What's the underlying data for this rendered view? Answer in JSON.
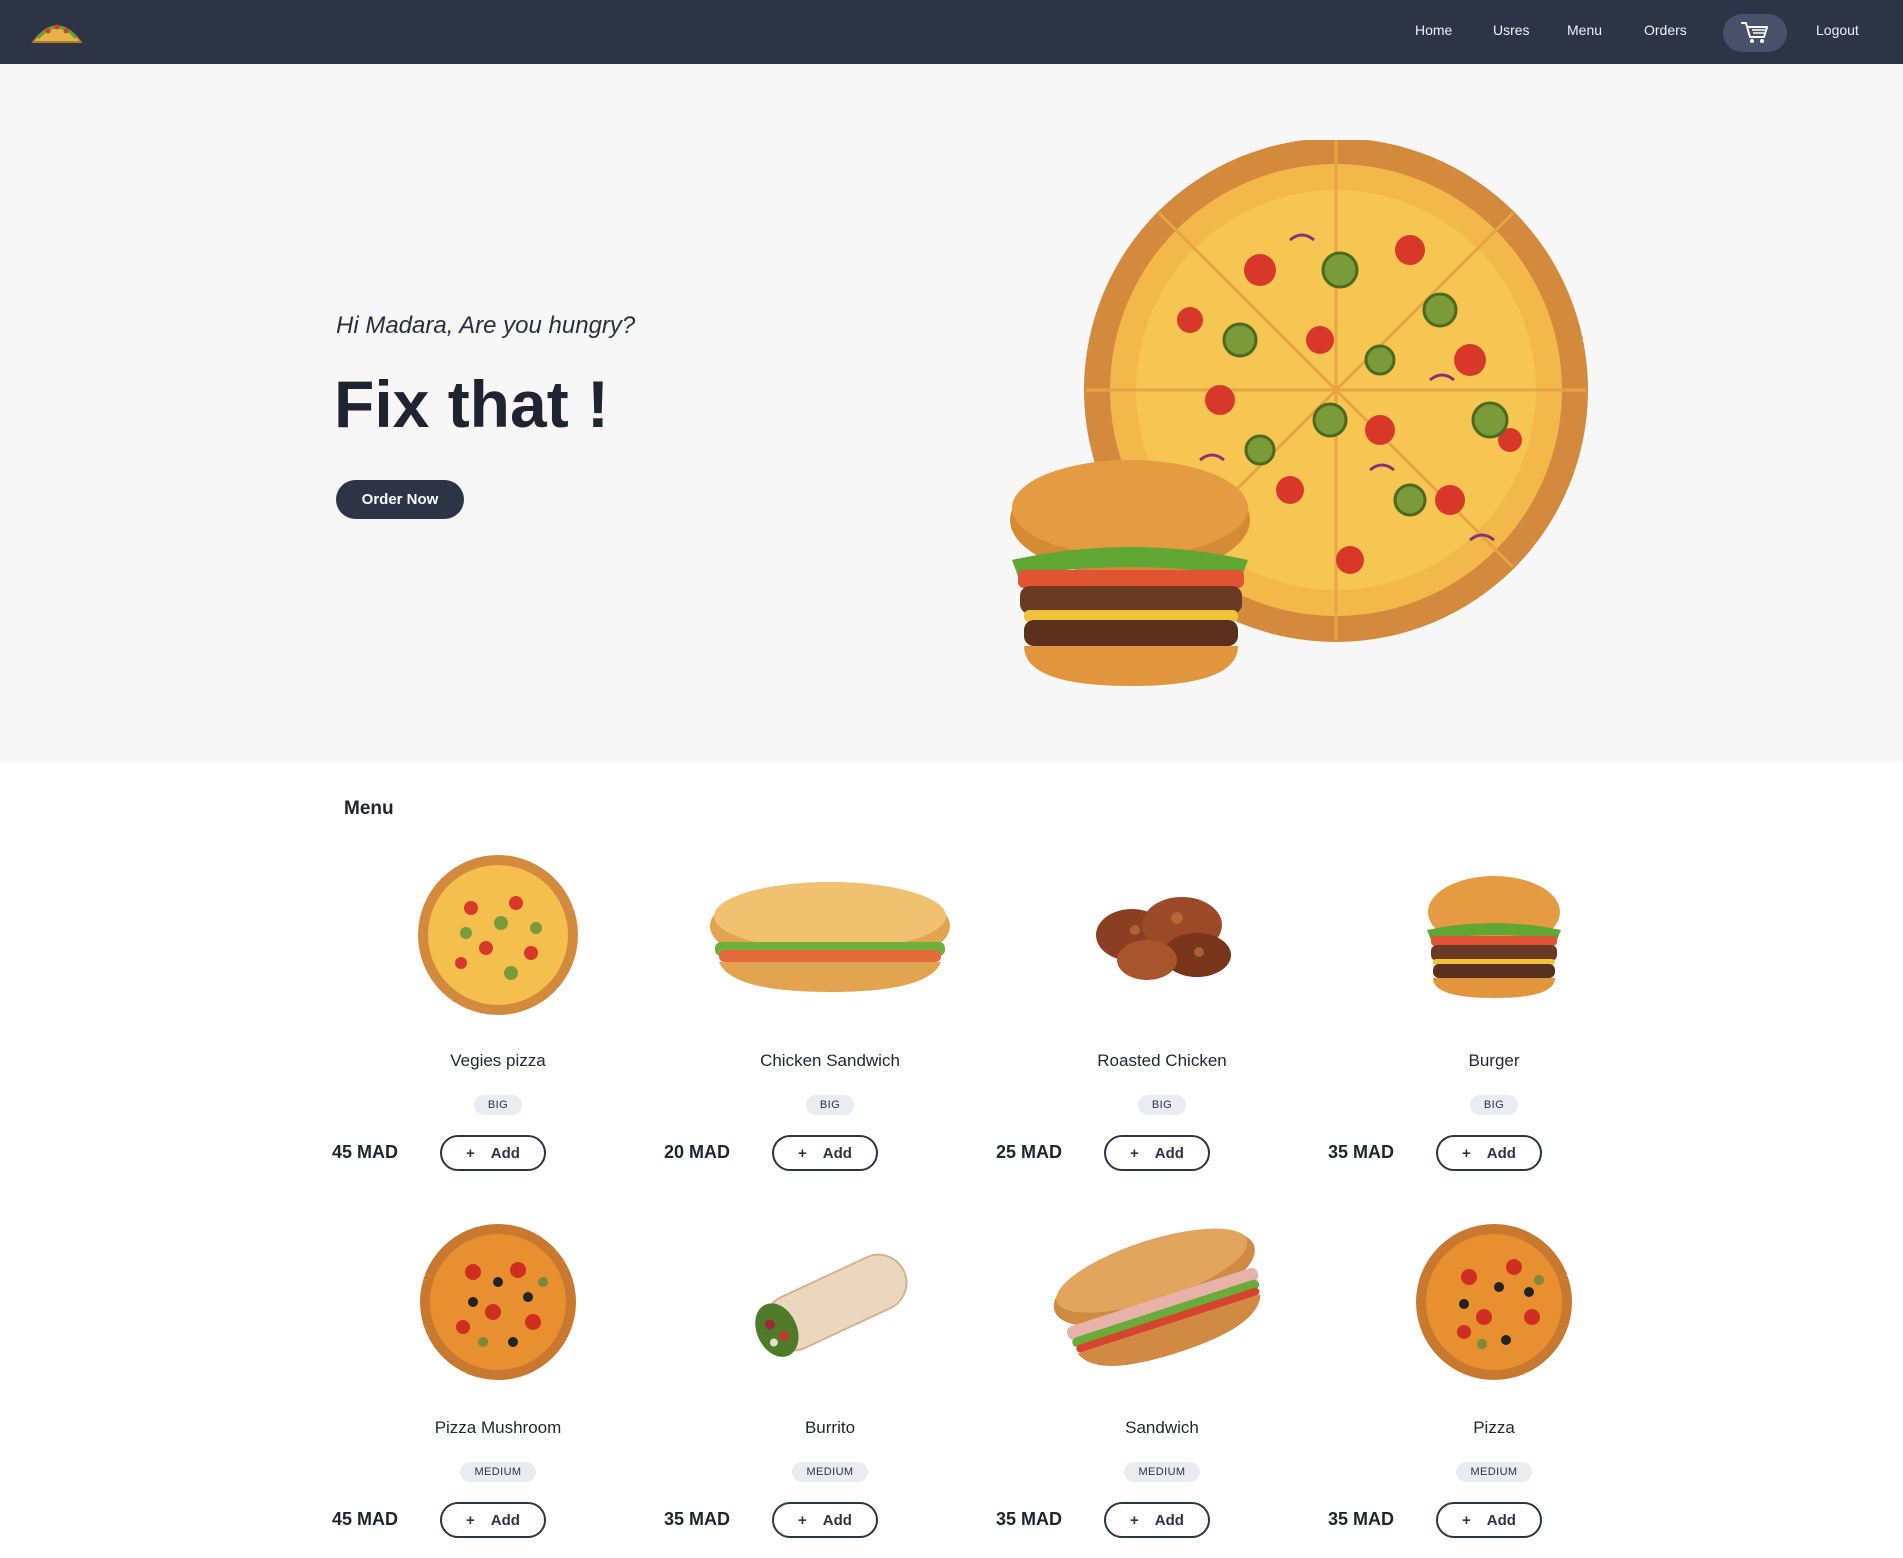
{
  "nav": {
    "links": [
      "Home",
      "Usres",
      "Menu",
      "Orders",
      "Logout"
    ]
  },
  "hero": {
    "greeting": "Hi Madara, Are you hungry?",
    "title": "Fix that !",
    "button": "Order Now"
  },
  "menu": {
    "heading": "Menu",
    "add_label": "Add",
    "items": [
      {
        "name": "Vegies pizza",
        "size": "BIG",
        "price": "45 MAD",
        "icon": "pizza-icon"
      },
      {
        "name": "Chicken Sandwich",
        "size": "BIG",
        "price": "20 MAD",
        "icon": "sandwich-icon"
      },
      {
        "name": "Roasted Chicken",
        "size": "BIG",
        "price": "25 MAD",
        "icon": "chicken-icon"
      },
      {
        "name": "Burger",
        "size": "BIG",
        "price": "35 MAD",
        "icon": "burger-icon"
      },
      {
        "name": "Pizza Mushroom",
        "size": "MEDIUM",
        "price": "45 MAD",
        "icon": "pizza-icon"
      },
      {
        "name": "Burrito",
        "size": "MEDIUM",
        "price": "35 MAD",
        "icon": "burrito-icon"
      },
      {
        "name": "Sandwich",
        "size": "MEDIUM",
        "price": "35 MAD",
        "icon": "sandwich-icon"
      },
      {
        "name": "Pizza",
        "size": "MEDIUM",
        "price": "35 MAD",
        "icon": "pizza-icon"
      }
    ]
  },
  "colors": {
    "navbar": "#2d3446",
    "hero_bg": "#f7f7f7",
    "badge": "#e8edf3",
    "accent": "#2d3446"
  }
}
